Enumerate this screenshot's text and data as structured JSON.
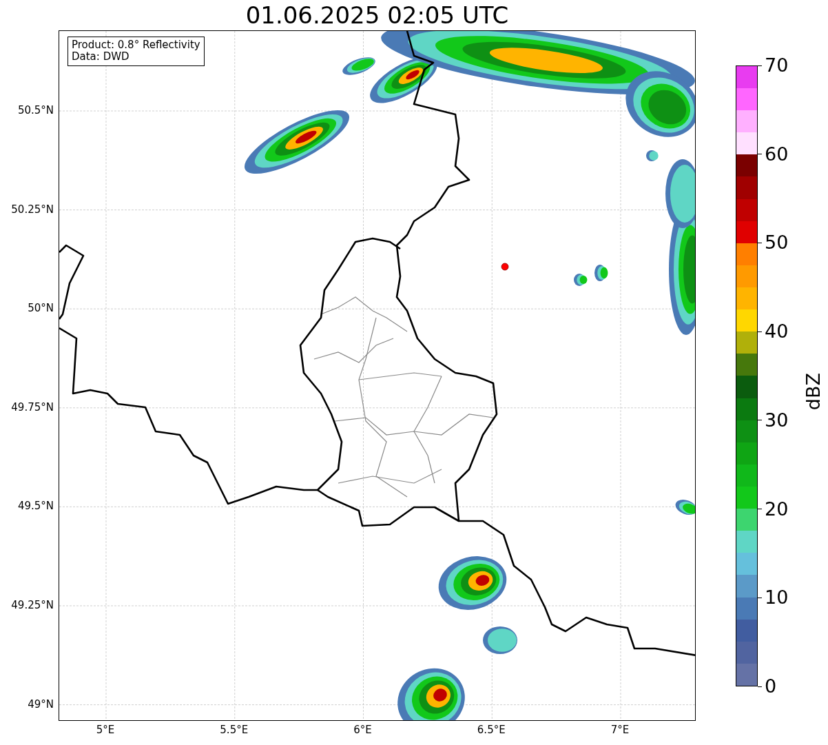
{
  "title": "01.06.2025 02:05 UTC",
  "info_box": {
    "lines": [
      "Product: 0.8° Reflectivity",
      "Data: DWD"
    ]
  },
  "map": {
    "lat_labels": [
      "50.5°N",
      "50.25°N",
      "50°N",
      "49.75°N",
      "49.5°N",
      "49.25°N",
      "49°N"
    ],
    "lon_labels": [
      "5°E",
      "5.5°E",
      "6°E",
      "6.5°E",
      "7°E"
    ]
  },
  "colorbar": {
    "label": "dBZ",
    "tick_labels": [
      "70",
      "60",
      "50",
      "40",
      "30",
      "20",
      "10",
      "0"
    ],
    "bins": [
      {
        "color": "#6572a6"
      },
      {
        "color": "#5164a0"
      },
      {
        "color": "#415da0"
      },
      {
        "color": "#4a7ab5"
      },
      {
        "color": "#5b9ac8"
      },
      {
        "color": "#65c0dc"
      },
      {
        "color": "#5fd6c5"
      },
      {
        "color": "#3dd56f"
      },
      {
        "color": "#12c81a"
      },
      {
        "color": "#10b81a"
      },
      {
        "color": "#0fa514"
      },
      {
        "color": "#0e9014"
      },
      {
        "color": "#0b7a10"
      },
      {
        "color": "#0b5c0e"
      },
      {
        "color": "#46780c"
      },
      {
        "color": "#b0b00a"
      },
      {
        "color": "#ffd700"
      },
      {
        "color": "#ffb400"
      },
      {
        "color": "#ff9a00"
      },
      {
        "color": "#ff7f00"
      },
      {
        "color": "#e00000"
      },
      {
        "color": "#c00000"
      },
      {
        "color": "#a00000"
      },
      {
        "color": "#7a0000"
      },
      {
        "color": "#ffe0ff"
      },
      {
        "color": "#ffb0ff"
      },
      {
        "color": "#ff66ff"
      },
      {
        "color": "#e83cf0"
      }
    ]
  }
}
